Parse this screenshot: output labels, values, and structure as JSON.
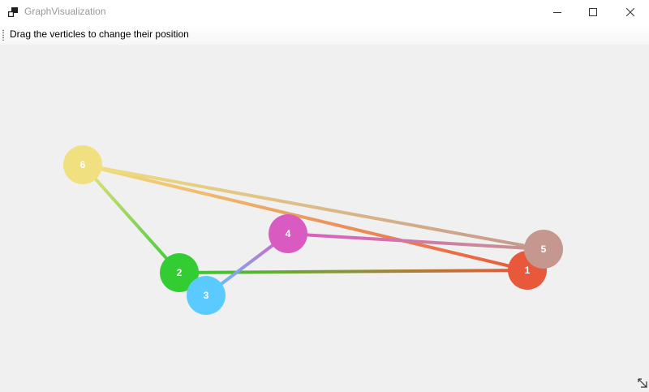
{
  "window": {
    "title": "GraphVisualization",
    "controls": {
      "minimize": "minimize-icon",
      "maximize": "maximize-icon",
      "close": "close-icon"
    }
  },
  "toolbar": {
    "label": "Drag the verticles to change their position"
  },
  "graph": {
    "vertices": [
      {
        "id": "1",
        "color": "#e8583a"
      },
      {
        "id": "2",
        "color": "#33cc33"
      },
      {
        "id": "3",
        "color": "#5bcbff"
      },
      {
        "id": "4",
        "color": "#d95bc2"
      },
      {
        "id": "5",
        "color": "#c5978e"
      },
      {
        "id": "6",
        "color": "#f0e080"
      }
    ],
    "edges": [
      {
        "from": "6",
        "to": "2"
      },
      {
        "from": "6",
        "to": "1"
      },
      {
        "from": "6",
        "to": "5"
      },
      {
        "from": "2",
        "to": "1"
      },
      {
        "from": "3",
        "to": "4"
      },
      {
        "from": "4",
        "to": "5"
      }
    ]
  }
}
